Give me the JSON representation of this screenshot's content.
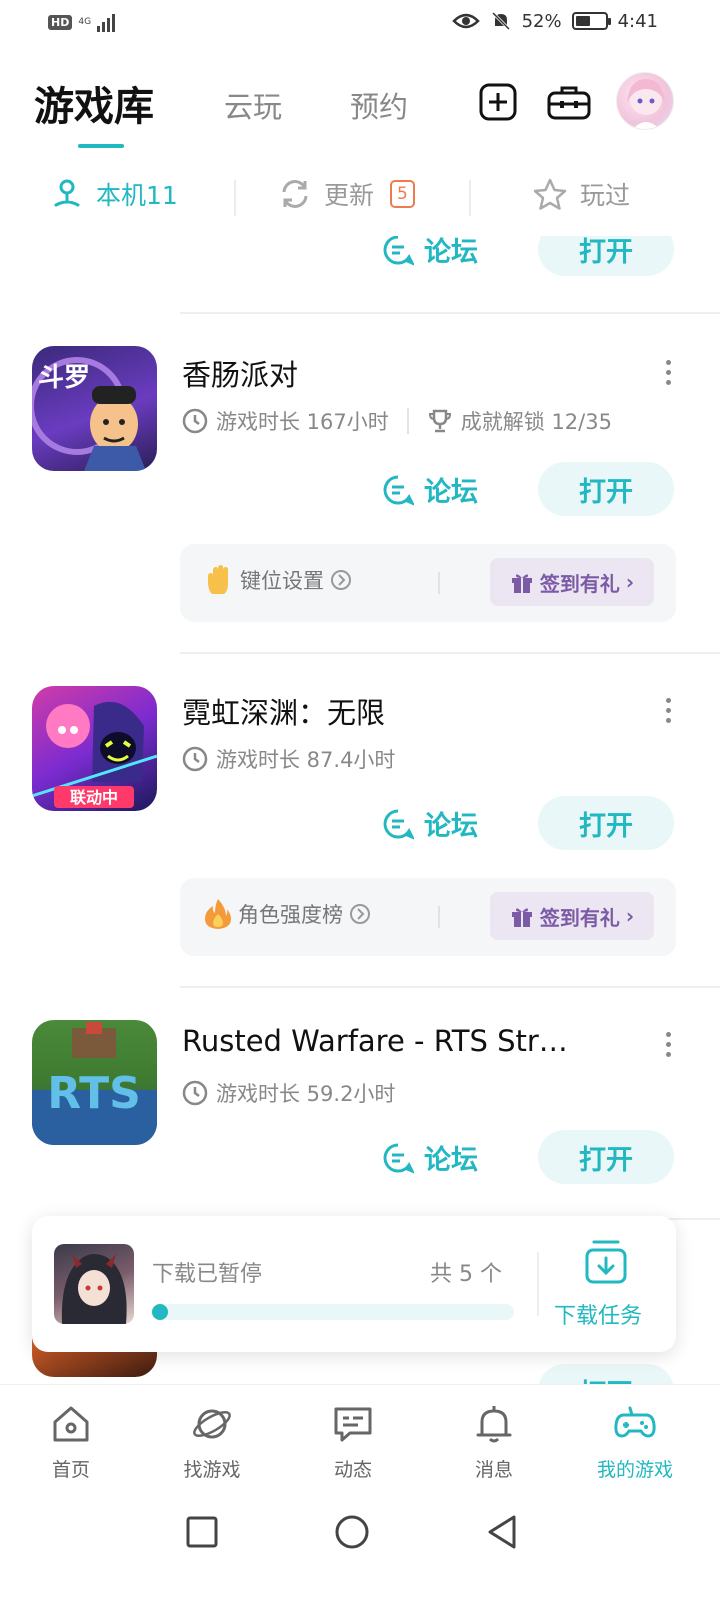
{
  "status_bar": {
    "hd": "HD",
    "network": "4G",
    "battery": "52%",
    "battery_level": 0.52,
    "time": "4:41",
    "icons": [
      "eye-icon",
      "bell-muted-icon",
      "battery-icon",
      "signal-icon"
    ]
  },
  "header": {
    "tabs": [
      {
        "label": "游戏库",
        "active": true
      },
      {
        "label": "云玩",
        "active": false
      },
      {
        "label": "预约",
        "active": false
      }
    ],
    "actions": [
      "add-icon",
      "toolbox-icon",
      "avatar"
    ]
  },
  "subtabs": {
    "local": {
      "label": "本机11",
      "icon": "phone-stand-icon"
    },
    "update": {
      "label": "更新",
      "badge": "5",
      "icon": "refresh-icon"
    },
    "played": {
      "label": "玩过",
      "icon": "star-icon"
    }
  },
  "partial_top_row": {
    "forum_label": "论坛",
    "open_label": "打开"
  },
  "games": [
    {
      "title": "香肠派对",
      "playtime": "游戏时长 167小时",
      "achievement": "成就解锁 12/35",
      "forum_label": "论坛",
      "open_label": "打开",
      "card_left_label": "键位设置",
      "card_left_icon": "hand-icon",
      "gift_label": "签到有礼"
    },
    {
      "title": "霓虹深渊：无限",
      "playtime": "游戏时长 87.4小时",
      "icon_badge": "联动中",
      "forum_label": "论坛",
      "open_label": "打开",
      "card_left_label": "角色强度榜",
      "card_left_icon": "fire-icon",
      "gift_label": "签到有礼"
    },
    {
      "title": "Rusted Warfare - RTS Str…",
      "playtime": "游戏时长 59.2小时",
      "icon_badge": "RTS",
      "forum_label": "论坛",
      "open_label": "打开"
    }
  ],
  "download": {
    "status": "下载已暂停",
    "count": "共 5 个",
    "task_label": "下载任务",
    "progress": 0.02
  },
  "bottom_nav": [
    {
      "label": "首页",
      "icon": "home-icon",
      "active": false
    },
    {
      "label": "找游戏",
      "icon": "planet-icon",
      "active": false
    },
    {
      "label": "动态",
      "icon": "chat-icon",
      "active": false
    },
    {
      "label": "消息",
      "icon": "bell-icon",
      "active": false
    },
    {
      "label": "我的游戏",
      "icon": "gamepad-icon",
      "active": true
    }
  ],
  "colors": {
    "accent": "#22b8c2",
    "badge": "#f07a50",
    "gift": "#7b5aa6"
  }
}
